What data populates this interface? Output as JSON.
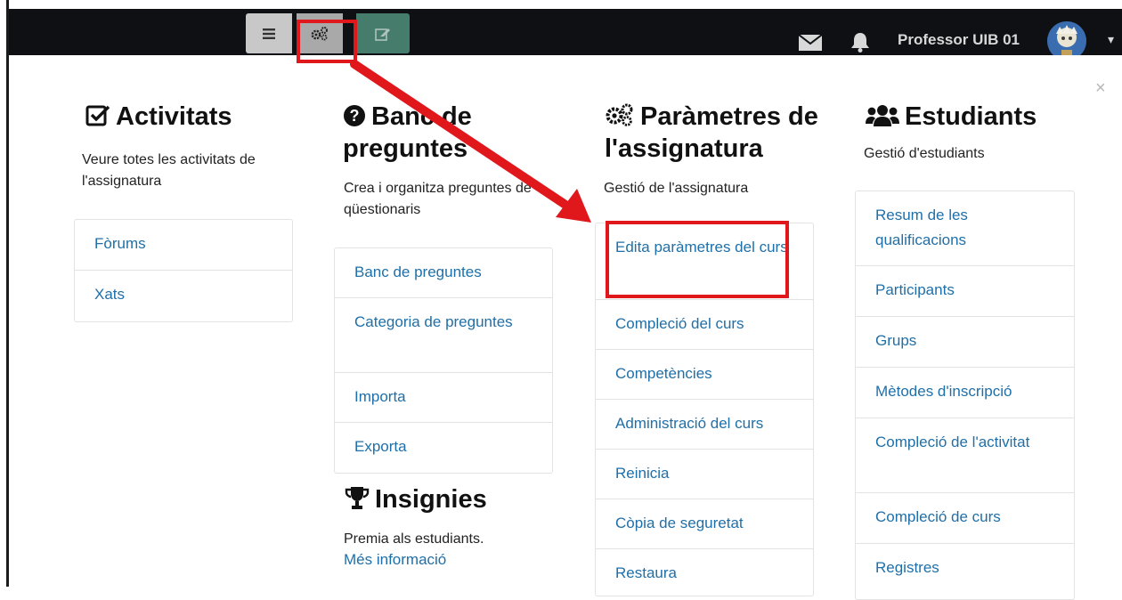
{
  "topbar": {
    "user_name": "Professor UIB 01",
    "icons": [
      "menu-icon",
      "gear-icon",
      "edit-icon",
      "mail-icon",
      "bell-icon",
      "caret-down-icon"
    ],
    "close_label": "×"
  },
  "columns": {
    "activitats": {
      "icon": "check-square-icon",
      "title": "Activitats",
      "desc": "Veure totes les activitats de l'assignatura",
      "items": [
        "Fòrums",
        "Xats"
      ]
    },
    "banc": {
      "icon": "question-circle-icon",
      "title": "Banc de preguntes",
      "desc": "Crea i organitza preguntes de qüestionaris",
      "items": [
        "Banc de preguntes",
        "Categoria de preguntes",
        "Importa",
        "Exporta"
      ]
    },
    "insignies": {
      "icon": "trophy-icon",
      "title": "Insignies",
      "desc": "Premia als estudiants.",
      "link": "Més informació"
    },
    "parametres": {
      "icon": "gears-icon",
      "title": "Paràmetres de l'assignatura",
      "desc": "Gestió de l'assignatura",
      "items": [
        "Edita paràmetres del curs",
        "Compleció del curs",
        "Competències",
        "Administració del curs",
        "Reinicia",
        "Còpia de seguretat",
        "Restaura"
      ]
    },
    "estudiants": {
      "icon": "users-icon",
      "title": "Estudiants",
      "desc": "Gestió d'estudiants",
      "items": [
        "Resum de les qualificacions",
        "Participants",
        "Grups",
        "Mètodes d'inscripció",
        "Compleció de l'activitat",
        "Compleció de curs",
        "Registres"
      ]
    }
  },
  "colors": {
    "topbar": "#0e1014",
    "link": "#1f6fa8",
    "highlight": "#e0171b"
  }
}
